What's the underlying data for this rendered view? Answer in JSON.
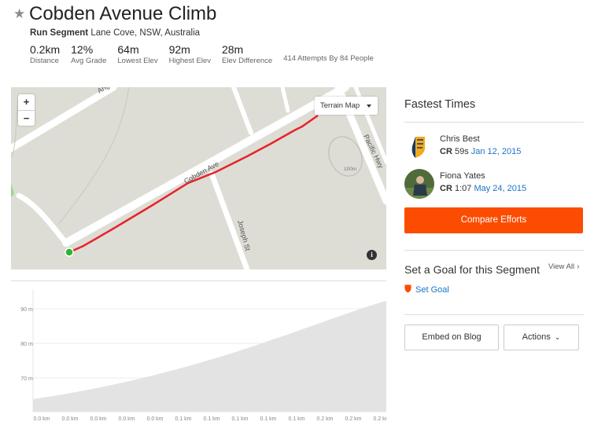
{
  "segment": {
    "title": "Cobden Avenue Climb",
    "type_label": "Run Segment",
    "location": "Lane Cove, NSW, Australia",
    "stats": [
      {
        "value": "0.2km",
        "label": "Distance"
      },
      {
        "value": "12%",
        "label": "Avg Grade"
      },
      {
        "value": "64m",
        "label": "Lowest Elev"
      },
      {
        "value": "92m",
        "label": "Highest Elev"
      },
      {
        "value": "28m",
        "label": "Elev Difference"
      }
    ],
    "attempts": "414 Attempts By 84 People"
  },
  "map": {
    "zoom_in": "+",
    "zoom_out": "−",
    "map_type": "Terrain Map",
    "info": "i",
    "street_labels": [
      "Angu",
      "Cobden Ave",
      "Joseph St",
      "Pacific Hwy"
    ],
    "contour_label": "100m",
    "route_color": "#e8232a",
    "start_color": "#2db52d"
  },
  "elevation": {
    "y_ticks": [
      "90 m",
      "80 m",
      "70 m"
    ],
    "x_ticks": [
      "0.0 km",
      "0.0 km",
      "0.0 km",
      "0.0 km",
      "0.0 km",
      "0.1 km",
      "0.1 km",
      "0.1 km",
      "0.1 km",
      "0.1 km",
      "0.2 km",
      "0.2 km",
      "0.2 km"
    ]
  },
  "fastest": {
    "heading": "Fastest Times",
    "athletes": [
      {
        "name": "Chris Best",
        "rank": "CR",
        "time": "59s",
        "date": "Jan 12, 2015"
      },
      {
        "name": "Fiona Yates",
        "rank": "CR",
        "time": "1:07",
        "date": "May 24, 2015"
      }
    ],
    "compare_button": "Compare Efforts"
  },
  "goal": {
    "heading": "Set a Goal for this Segment",
    "view_all": "View All",
    "set_goal": "Set Goal"
  },
  "actions": {
    "embed": "Embed on Blog",
    "actions": "Actions"
  },
  "colors": {
    "accent": "#fc4c02",
    "link": "#1a73c8"
  }
}
